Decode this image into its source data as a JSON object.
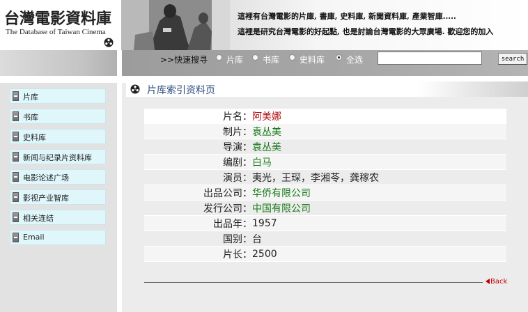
{
  "header": {
    "logo_title": "台灣電影資料庫",
    "logo_subtitle": "The Database of Taiwan Cinema",
    "tagline_1": "這裡有台灣電影的片庫, 書庫, 史料庫, 新聞資料庫, 產業智庫.....",
    "tagline_2": "這裡是研究台灣電影的好起點, 也是討論台灣電影的大眾廣場. 歡迎您的加入"
  },
  "search": {
    "label": ">>快速搜寻",
    "options": [
      {
        "label": "片库",
        "selected": false
      },
      {
        "label": "书库",
        "selected": false
      },
      {
        "label": "史料库",
        "selected": false
      },
      {
        "label": "全选",
        "selected": true
      }
    ],
    "query": "",
    "button_label": "search"
  },
  "sidebar": {
    "items": [
      {
        "label": "片库"
      },
      {
        "label": "书库"
      },
      {
        "label": "史料库"
      },
      {
        "label": "新闻与纪录片资料库"
      },
      {
        "label": "电影论述广场"
      },
      {
        "label": "影视产业智库"
      },
      {
        "label": "相关连结"
      },
      {
        "label": "Email"
      }
    ]
  },
  "page": {
    "title": "片库索引资料页",
    "colon": "：",
    "fields": [
      {
        "key": "片名",
        "value": "阿美娜"
      },
      {
        "key": "制片",
        "value": "袁丛美"
      },
      {
        "key": "导演",
        "value": "袁丛美"
      },
      {
        "key": "编剧",
        "value": "白马"
      },
      {
        "key": "演员",
        "value": "夷光，王琛，李湘苓，龚稼农"
      },
      {
        "key": "出品公司",
        "value": "华侨有限公司"
      },
      {
        "key": "发行公司",
        "value": "中国有限公司"
      },
      {
        "key": "出品年",
        "value": "1957"
      },
      {
        "key": "国别",
        "value": "台"
      },
      {
        "key": "片长",
        "value": "2500"
      }
    ],
    "back_label": "Back"
  },
  "colors": {
    "nav_item_bg": "#dff6fb",
    "title_blue": "#2c4d80",
    "film_title_red": "#b01010",
    "link_green": "#1a7a1a",
    "back_red": "#c00000"
  }
}
